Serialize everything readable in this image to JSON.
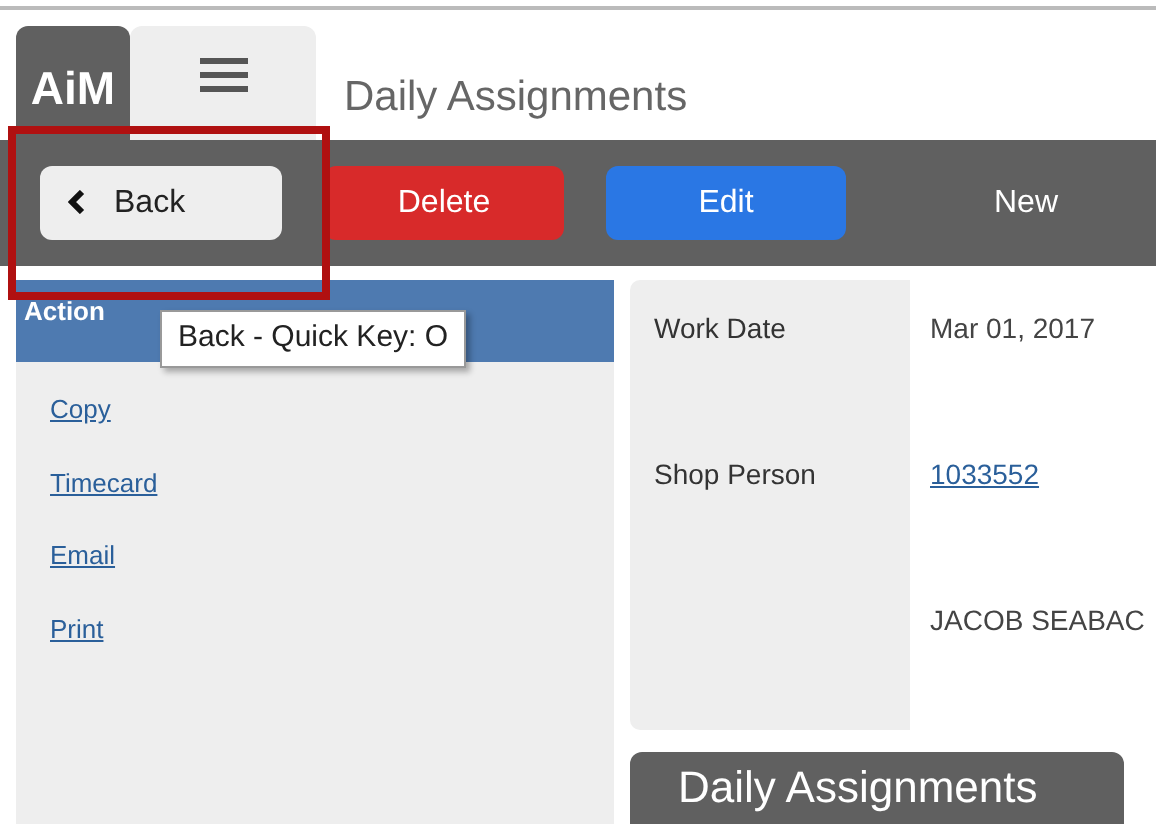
{
  "header": {
    "logo": "AiM",
    "title": "Daily Assignments"
  },
  "toolbar": [
    {
      "kind": "back",
      "label": "Back"
    },
    {
      "kind": "danger",
      "label": "Delete"
    },
    {
      "kind": "primary",
      "label": "Edit"
    },
    {
      "kind": "plain",
      "label": "New"
    }
  ],
  "tooltip": "Back - Quick Key: O",
  "sidebar": {
    "title": "Action",
    "links": [
      "Copy",
      "Timecard",
      "Email",
      "Print"
    ]
  },
  "form": [
    {
      "label": "Work Date",
      "value": "Mar 01, 2017",
      "kind": "text"
    },
    {
      "label": "Shop Person",
      "value": "1033552",
      "kind": "link"
    },
    {
      "value": "JACOB SEABAC",
      "kind": "text"
    }
  ],
  "section_tab": "Daily Assignments"
}
